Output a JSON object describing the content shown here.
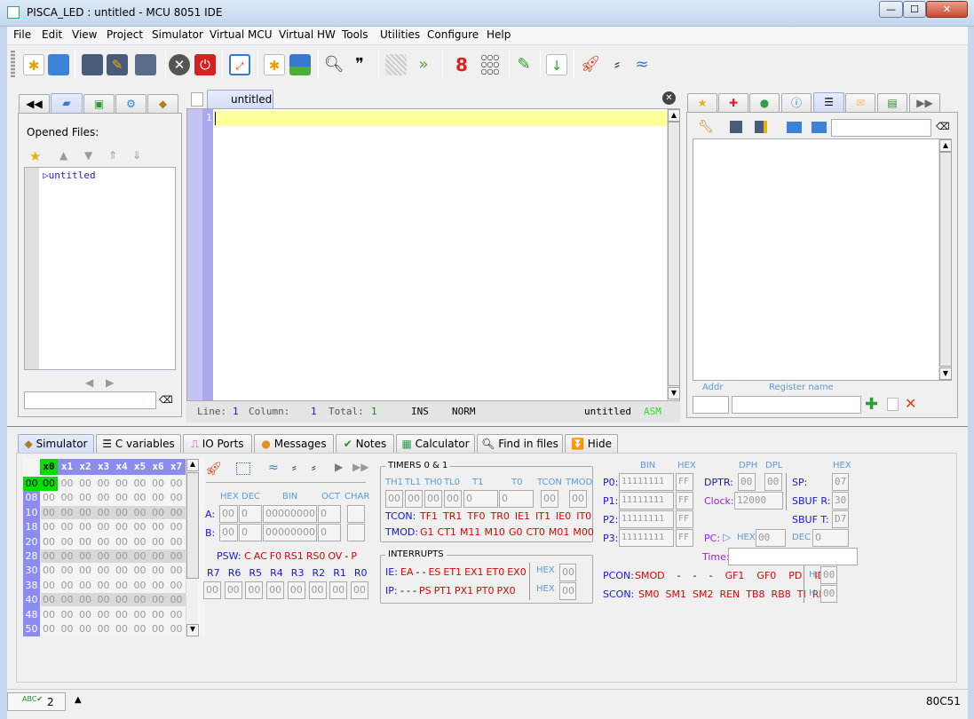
{
  "window": {
    "title": "PISCA_LED : untitled - MCU 8051 IDE",
    "buttons": [
      "—",
      "☐",
      "✕"
    ]
  },
  "menu": [
    "File",
    "Edit",
    "View",
    "Project",
    "Simulator",
    "Virtual MCU",
    "Virtual HW",
    "Tools",
    "Utilities",
    "Configure",
    "Help"
  ],
  "toolbar": [
    "new-file",
    "open-file",
    "save",
    "save-as",
    "save-all",
    "close-file",
    "exit",
    "fullscreen",
    "new-project",
    "open-project",
    "find",
    "goto",
    "disabled",
    "forward",
    "seven-segment",
    "led-matrix",
    "edit",
    "hex-file",
    "start-simulator",
    "step",
    "animate"
  ],
  "left_panel": {
    "tabs": [
      "back",
      "opened-files",
      "project-files",
      "settings",
      "sfr"
    ],
    "title": "Opened Files:",
    "files": [
      "untitled"
    ],
    "search_value": ""
  },
  "editor": {
    "tab_label": "untitled",
    "line_number": "1",
    "status": {
      "line_label": "Line:",
      "line": "1",
      "column_label": "Column:",
      "column": "1",
      "total_label": "Total:",
      "total": "1",
      "mode": "INS",
      "selection": "NORM",
      "file": "untitled",
      "type": "ASM"
    }
  },
  "right_panel": {
    "tabs": [
      "bookmarks",
      "breakpoints",
      "symbols",
      "info",
      "register-watches",
      "notes",
      "hardware",
      "more"
    ],
    "search_value": "",
    "addr_label": "Addr",
    "register_label": "Register name",
    "addr_value": "",
    "register_value": ""
  },
  "bottom_tabs": [
    "Simulator",
    "C variables",
    "IO Ports",
    "Messages",
    "Notes",
    "Calculator",
    "Find in files",
    "Hide"
  ],
  "simulator": {
    "memory": {
      "columns": [
        "x0",
        "x1",
        "x2",
        "x3",
        "x4",
        "x5",
        "x6",
        "x7"
      ],
      "rows": [
        "00",
        "08",
        "10",
        "18",
        "20",
        "28",
        "30",
        "38",
        "40",
        "48",
        "50"
      ],
      "value": "00"
    },
    "accumulators": {
      "headers": [
        "HEX",
        "DEC",
        "BIN",
        "OCT",
        "CHAR"
      ],
      "A": {
        "label": "A:",
        "hex": "00",
        "dec": "0",
        "bin": "00000000",
        "oct": "0",
        "char": ""
      },
      "B": {
        "label": "B:",
        "hex": "00",
        "dec": "0",
        "bin": "00000000",
        "oct": "0",
        "char": ""
      }
    },
    "psw": {
      "label": "PSW:",
      "bits": [
        "C",
        "AC",
        "F0",
        "RS1",
        "RS0",
        "OV",
        "-",
        "P"
      ]
    },
    "registers": {
      "labels": [
        "R7",
        "R6",
        "R5",
        "R4",
        "R3",
        "R2",
        "R1",
        "R0"
      ],
      "values": [
        "00",
        "00",
        "00",
        "00",
        "00",
        "00",
        "00",
        "00"
      ]
    },
    "timers": {
      "title": "TIMERS 0 & 1",
      "headers": [
        "TH1",
        "TL1",
        "TH0",
        "TL0",
        "T1",
        "T0",
        "TCON",
        "TMOD"
      ],
      "values": [
        "00",
        "00",
        "00",
        "00",
        "0",
        "0",
        "00",
        "00"
      ],
      "tcon_label": "TCON:",
      "tcon_bits": [
        "TF1",
        "TR1",
        "TF0",
        "TR0",
        "IE1",
        "IT1",
        "IE0",
        "IT0"
      ],
      "tmod_label": "TMOD:",
      "tmod_bits": [
        "G1",
        "CT1",
        "M11",
        "M10",
        "G0",
        "CT0",
        "M01",
        "M00"
      ]
    },
    "interrupts": {
      "title": "INTERRUPTS",
      "ie_label": "IE:",
      "ie_bits": [
        "EA",
        "-",
        "-",
        "ES",
        "ET1",
        "EX1",
        "ET0",
        "EX0"
      ],
      "ip_label": "IP:",
      "ip_bits": [
        "-",
        "-",
        "-",
        "PS",
        "PT1",
        "PX1",
        "PT0",
        "PX0"
      ],
      "hex_label": "HEX",
      "ie_hex": "00",
      "ip_hex": "00"
    },
    "ports": {
      "bin_label": "BIN",
      "hex_label": "HEX",
      "rows": [
        {
          "label": "P0:",
          "bin": "11111111",
          "hex": "FF"
        },
        {
          "label": "P1:",
          "bin": "11111111",
          "hex": "FF"
        },
        {
          "label": "P2:",
          "bin": "11111111",
          "hex": "FF"
        },
        {
          "label": "P3:",
          "bin": "11111111",
          "hex": "FF"
        }
      ]
    },
    "dptr": {
      "label": "DPTR:",
      "dph_label": "DPH",
      "dpl_label": "DPL",
      "dph": "00",
      "dpl": "00"
    },
    "clock": {
      "label": "Clock:",
      "value": "12000"
    },
    "sp": {
      "label": "SP:",
      "hex_label": "HEX",
      "value": "07"
    },
    "sbuf_r": {
      "label": "SBUF R:",
      "value": "30"
    },
    "sbuf_t": {
      "label": "SBUF T:",
      "value": "D7"
    },
    "pc": {
      "label": "PC:",
      "hex_label": "HEX",
      "hex": "00",
      "dec_label": "DEC",
      "dec": "0"
    },
    "time": {
      "label": "Time:",
      "value": ""
    },
    "pcon": {
      "label": "PCON:",
      "bits": [
        "SMOD",
        "-",
        "-",
        "-",
        "GF1",
        "GF0",
        "PD",
        "IDL"
      ],
      "h_label": "H:",
      "value": "00"
    },
    "scon": {
      "label": "SCON:",
      "bits": [
        "SM0",
        "SM1",
        "SM2",
        "REN",
        "TB8",
        "RB8",
        "TI",
        "RI"
      ],
      "h_label": "H:",
      "value": "00"
    }
  },
  "statusbar": {
    "spell_count": "2",
    "mcu": "80C51"
  },
  "colors": {
    "accent": "#8c8cf0",
    "highlight_line": "#ffff99",
    "pc_marker": "#00e000",
    "bit_red": "#e00000",
    "label_blue": "#1515e0"
  }
}
